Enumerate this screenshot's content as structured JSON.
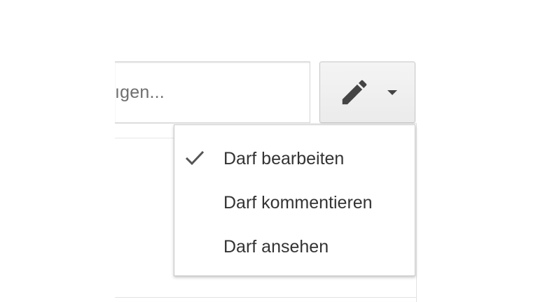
{
  "share_input": {
    "visible_text": "ıgen..."
  },
  "permission_button": {
    "icon": "pencil-icon",
    "caret": "chevron-down-icon"
  },
  "permission_menu": {
    "items": [
      {
        "label": "Darf bearbeiten",
        "selected": true
      },
      {
        "label": "Darf kommentieren",
        "selected": false
      },
      {
        "label": "Darf ansehen",
        "selected": false
      }
    ]
  },
  "colors": {
    "text": "#333333",
    "placeholder_text": "#6e6e6e",
    "button_bg": "#f1f1f1",
    "border": "#c6c6c6"
  }
}
